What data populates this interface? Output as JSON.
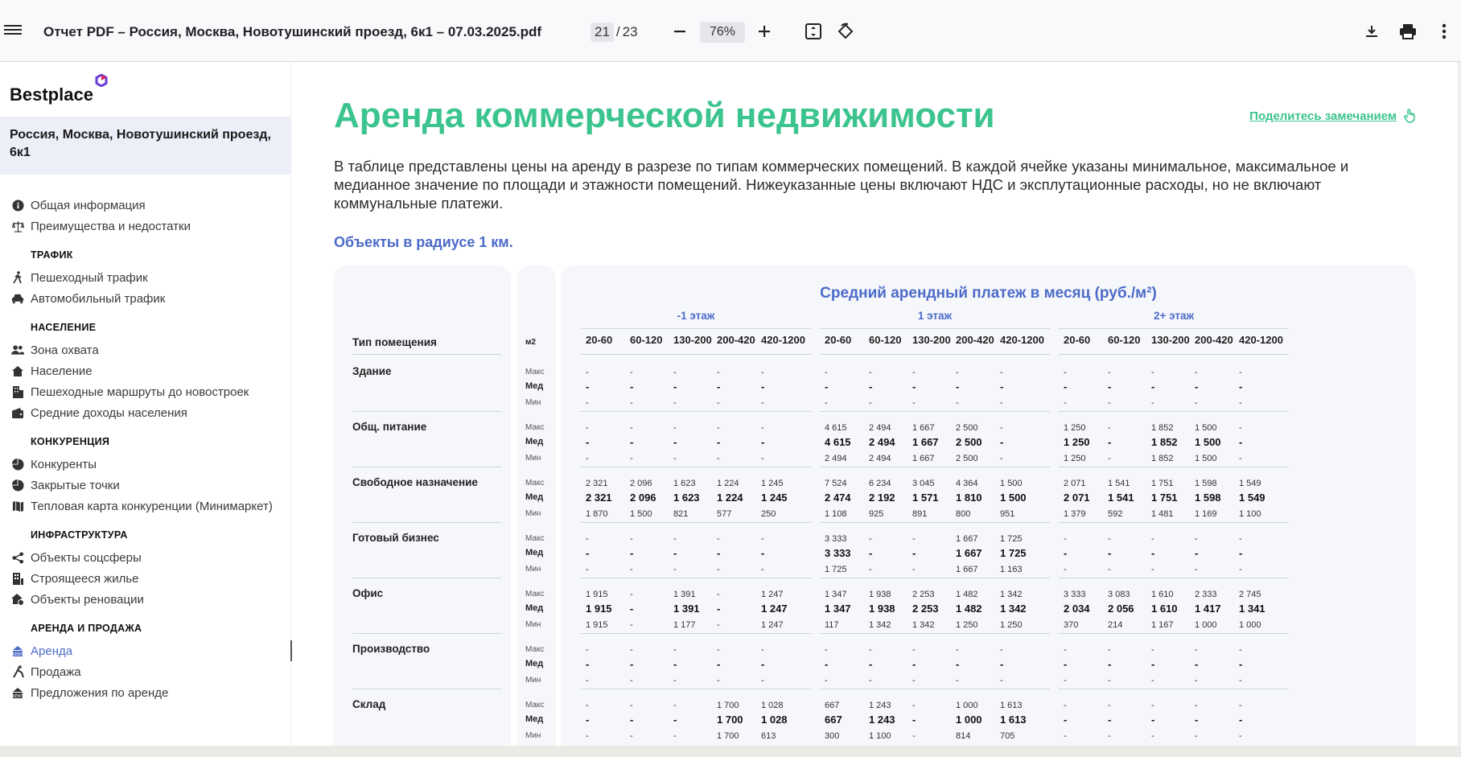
{
  "viewer": {
    "title": "Отчет PDF – Россия, Москва, Новотушинский проезд, 6к1 – 07.03.2025.pdf",
    "page_current": "21",
    "page_sep": "/",
    "page_total": "23",
    "zoom": "76%",
    "icons": [
      "menu-icon",
      "minus-icon",
      "plus-icon",
      "fit-page-icon",
      "rotate-icon",
      "download-icon",
      "print-icon",
      "more-vert-icon"
    ]
  },
  "sidebar": {
    "logo": "Bestplace",
    "address": "Россия, Москва, Новотушинский проезд, 6к1",
    "top_items": [
      {
        "label": "Общая информация",
        "icon": "info-icon"
      },
      {
        "label": "Преимущества и недостатки",
        "icon": "scales-icon"
      }
    ],
    "sections": [
      {
        "title": "ТРАФИК",
        "items": [
          {
            "label": "Пешеходный трафик",
            "icon": "walk-icon"
          },
          {
            "label": "Автомобильный трафик",
            "icon": "car-icon"
          }
        ]
      },
      {
        "title": "НАСЕЛЕНИЕ",
        "items": [
          {
            "label": "Зона охвата",
            "icon": "people-icon"
          },
          {
            "label": "Население",
            "icon": "home-icon"
          },
          {
            "label": "Пешеходные маршруты до новостроек",
            "icon": "building-icon"
          },
          {
            "label": "Средние доходы населения",
            "icon": "wallet-icon"
          }
        ]
      },
      {
        "title": "КОНКУРЕНЦИЯ",
        "items": [
          {
            "label": "Конкуренты",
            "icon": "pie-icon"
          },
          {
            "label": "Закрытые точки",
            "icon": "pie-icon"
          },
          {
            "label": "Тепловая карта конкуренции (Минимаркет)",
            "icon": "map-icon"
          }
        ]
      },
      {
        "title": "ИНФРАСТРУКТУРА",
        "items": [
          {
            "label": "Объекты соцсферы",
            "icon": "share-icon"
          },
          {
            "label": "Строящееся жилье",
            "icon": "construction-icon"
          },
          {
            "label": "Объекты реновации",
            "icon": "renovation-icon"
          }
        ]
      },
      {
        "title": "АРЕНДА И ПРОДАЖА",
        "items": [
          {
            "label": "Аренда",
            "icon": "rent-icon",
            "active": true
          },
          {
            "label": "Продажа",
            "icon": "sale-icon"
          },
          {
            "label": "Предложения по аренде",
            "icon": "offer-icon"
          }
        ]
      }
    ]
  },
  "content": {
    "title": "Аренда коммерческой недвижимости",
    "share_label": "Поделитесь замечанием",
    "description": "В таблице представлены цены на аренду в разрезе по типам коммерческих помещений. В каждой ячейке указаны минимальное, максимальное и медианное значение по площади и этажности помещений. Нижеуказанные цены включают НДС и эксплутационные расходы, но не включают коммунальные платежи.",
    "subheading": "Объекты в радиусе 1 км."
  },
  "table": {
    "title": "Средний арендный платеж в месяц (руб./м²)",
    "type_header": "Тип помещения",
    "unit_header": "м2",
    "stat_labels": [
      "Макс",
      "Мед",
      "Мин"
    ],
    "floors": [
      "-1 этаж",
      "1 этаж",
      "2+ этаж"
    ],
    "ranges": [
      "20-60",
      "60-120",
      "130-200",
      "200-420",
      "420-1200"
    ],
    "rows": [
      {
        "name": "Здание",
        "values": [
          [
            "-",
            "-",
            "-",
            "-",
            "-",
            "-",
            "-",
            "-",
            "-",
            "-",
            "-",
            "-",
            "-",
            "-",
            "-"
          ],
          [
            "-",
            "-",
            "-",
            "-",
            "-",
            "-",
            "-",
            "-",
            "-",
            "-",
            "-",
            "-",
            "-",
            "-",
            "-"
          ],
          [
            "-",
            "-",
            "-",
            "-",
            "-",
            "-",
            "-",
            "-",
            "-",
            "-",
            "-",
            "-",
            "-",
            "-",
            "-"
          ]
        ]
      },
      {
        "name": "Общ. питание",
        "values": [
          [
            "-",
            "-",
            "-",
            "-",
            "-",
            "4 615",
            "2 494",
            "1 667",
            "2 500",
            "-",
            "1 250",
            "-",
            "1 852",
            "1 500",
            "-"
          ],
          [
            "-",
            "-",
            "-",
            "-",
            "-",
            "4 615",
            "2 494",
            "1 667",
            "2 500",
            "-",
            "1 250",
            "-",
            "1 852",
            "1 500",
            "-"
          ],
          [
            "-",
            "-",
            "-",
            "-",
            "-",
            "2 494",
            "2 494",
            "1 667",
            "2 500",
            "-",
            "1 250",
            "-",
            "1 852",
            "1 500",
            "-"
          ]
        ]
      },
      {
        "name": "Свободное назначение",
        "values": [
          [
            "2 321",
            "2 096",
            "1 623",
            "1 224",
            "1 245",
            "7 524",
            "6 234",
            "3 045",
            "4 364",
            "1 500",
            "2 071",
            "1 541",
            "1 751",
            "1 598",
            "1 549"
          ],
          [
            "2 321",
            "2 096",
            "1 623",
            "1 224",
            "1 245",
            "2 474",
            "2 192",
            "1 571",
            "1 810",
            "1 500",
            "2 071",
            "1 541",
            "1 751",
            "1 598",
            "1 549"
          ],
          [
            "1 870",
            "1 500",
            "821",
            "577",
            "250",
            "1 108",
            "925",
            "891",
            "800",
            "951",
            "1 379",
            "592",
            "1 481",
            "1 169",
            "1 100"
          ]
        ]
      },
      {
        "name": "Готовый бизнес",
        "values": [
          [
            "-",
            "-",
            "-",
            "-",
            "-",
            "3 333",
            "-",
            "-",
            "1 667",
            "1 725",
            "-",
            "-",
            "-",
            "-",
            "-"
          ],
          [
            "-",
            "-",
            "-",
            "-",
            "-",
            "3 333",
            "-",
            "-",
            "1 667",
            "1 725",
            "-",
            "-",
            "-",
            "-",
            "-"
          ],
          [
            "-",
            "-",
            "-",
            "-",
            "-",
            "1 725",
            "-",
            "-",
            "1 667",
            "1 163",
            "-",
            "-",
            "-",
            "-",
            "-"
          ]
        ]
      },
      {
        "name": "Офис",
        "values": [
          [
            "1 915",
            "-",
            "1 391",
            "-",
            "1 247",
            "1 347",
            "1 938",
            "2 253",
            "1 482",
            "1 342",
            "3 333",
            "3 083",
            "1 610",
            "2 333",
            "2 745"
          ],
          [
            "1 915",
            "-",
            "1 391",
            "-",
            "1 247",
            "1 347",
            "1 938",
            "2 253",
            "1 482",
            "1 342",
            "2 034",
            "2 056",
            "1 610",
            "1 417",
            "1 341"
          ],
          [
            "1 915",
            "-",
            "1 177",
            "-",
            "1 247",
            "117",
            "1 342",
            "1 342",
            "1 250",
            "1 250",
            "370",
            "214",
            "1 167",
            "1 000",
            "1 000"
          ]
        ]
      },
      {
        "name": "Производство",
        "values": [
          [
            "-",
            "-",
            "-",
            "-",
            "-",
            "-",
            "-",
            "-",
            "-",
            "-",
            "-",
            "-",
            "-",
            "-",
            "-"
          ],
          [
            "-",
            "-",
            "-",
            "-",
            "-",
            "-",
            "-",
            "-",
            "-",
            "-",
            "-",
            "-",
            "-",
            "-",
            "-"
          ],
          [
            "-",
            "-",
            "-",
            "-",
            "-",
            "-",
            "-",
            "-",
            "-",
            "-",
            "-",
            "-",
            "-",
            "-",
            "-"
          ]
        ]
      },
      {
        "name": "Склад",
        "values": [
          [
            "-",
            "-",
            "-",
            "1 700",
            "1 028",
            "667",
            "1 243",
            "-",
            "1 000",
            "1 613",
            "-",
            "-",
            "-",
            "-",
            "-"
          ],
          [
            "-",
            "-",
            "-",
            "1 700",
            "1 028",
            "667",
            "1 243",
            "-",
            "1 000",
            "1 613",
            "-",
            "-",
            "-",
            "-",
            "-"
          ],
          [
            "-",
            "-",
            "-",
            "1 700",
            "613",
            "300",
            "1 100",
            "-",
            "814",
            "705",
            "-",
            "-",
            "-",
            "-",
            "-"
          ]
        ]
      }
    ]
  }
}
